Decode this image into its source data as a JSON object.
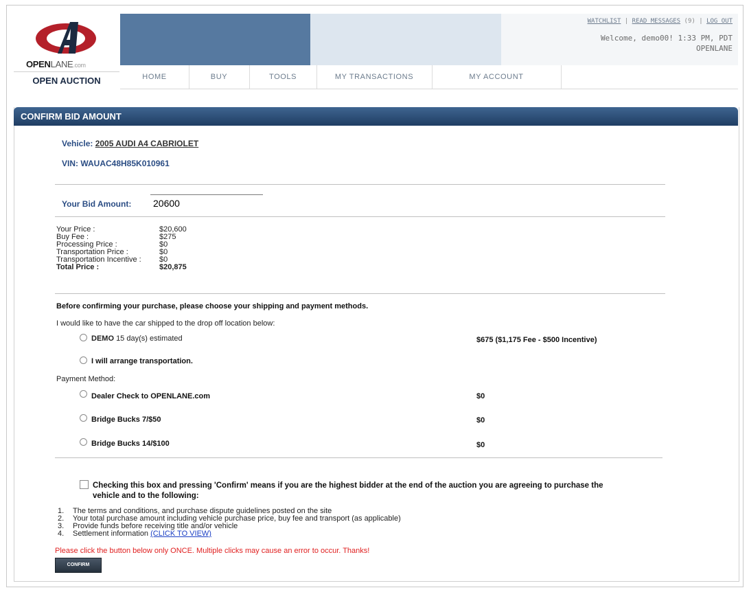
{
  "header": {
    "brand_main": "OPEN",
    "brand_light": "LANE",
    "brand_suffix": ".com",
    "auction_label": "OPEN AUCTION",
    "links": {
      "watchlist": "WATCHLIST",
      "read_messages": "READ MESSAGES",
      "message_count": "(9)",
      "logout": "LOG OUT"
    },
    "welcome_line": "Welcome, demo00! 1:33 PM, PDT",
    "company": "OPENLANE"
  },
  "nav": [
    "HOME",
    "BUY",
    "TOOLS",
    "MY TRANSACTIONS",
    "MY ACCOUNT"
  ],
  "panel": {
    "title": "CONFIRM BID AMOUNT"
  },
  "vehicle": {
    "label": "Vehicle:",
    "name": "2005 AUDI A4 CABRIOLET",
    "vin_label": "VIN:",
    "vin": "WAUAC48H85K010961"
  },
  "bid": {
    "label": "Your Bid Amount:",
    "value": "20600"
  },
  "prices": [
    {
      "label": "Your Price :",
      "value": "$20,600",
      "bold": false
    },
    {
      "label": "Buy Fee :",
      "value": "$275",
      "bold": false
    },
    {
      "label": "Processing Price :",
      "value": "$0",
      "bold": false
    },
    {
      "label": "Transportation Price :",
      "value": "$0",
      "bold": false
    },
    {
      "label": "Transportation Incentive :",
      "value": "$0",
      "bold": false
    },
    {
      "label": "Total Price :",
      "value": "$20,875",
      "bold": true
    }
  ],
  "shipping": {
    "intro": "Before confirming your purchase, please choose your shipping and payment methods.",
    "prompt": "I would like to have the car shipped to the drop off location below:",
    "options": [
      {
        "name": "DEMO",
        "detail": "15 day(s) estimated",
        "price": "$675 ($1,175 Fee - $500 Incentive)"
      },
      {
        "name": "I will arrange transportation.",
        "detail": "",
        "price": ""
      }
    ]
  },
  "payment": {
    "label": "Payment Method:",
    "options": [
      {
        "name": "Dealer Check to",
        "name_bold": "OPENLANE.com",
        "price": "$0"
      },
      {
        "name": "Bridge Bucks 7/$50",
        "name_bold": "",
        "price": "$0"
      },
      {
        "name": "Bridge Bucks 14/$100",
        "name_bold": "",
        "price": "$0"
      }
    ]
  },
  "agreement": {
    "line1": "Checking this box and pressing 'Confirm' means if you are the highest bidder at the end of the auction you are agreeing to purchase the",
    "line2": "vehicle and to the following:",
    "terms": [
      "The terms and conditions, and purchase dispute guidelines posted on the site",
      "Your total purchase amount including vehicle purchase price, buy fee and transport (as applicable)",
      "Provide funds before receiving title and/or vehicle",
      "Settlement information"
    ],
    "terms_link": "(CLICK TO VIEW)"
  },
  "warning": "Please click the button below only ONCE. Multiple clicks may cause an error to occur. Thanks!",
  "confirm_label": "CONFIRM",
  "colors": {
    "nav_band": "#5679a0",
    "title_bar": "#2b4d7a",
    "label_blue": "#2b4d84",
    "warning": "#e02020",
    "logo_red": "#b4202a"
  }
}
